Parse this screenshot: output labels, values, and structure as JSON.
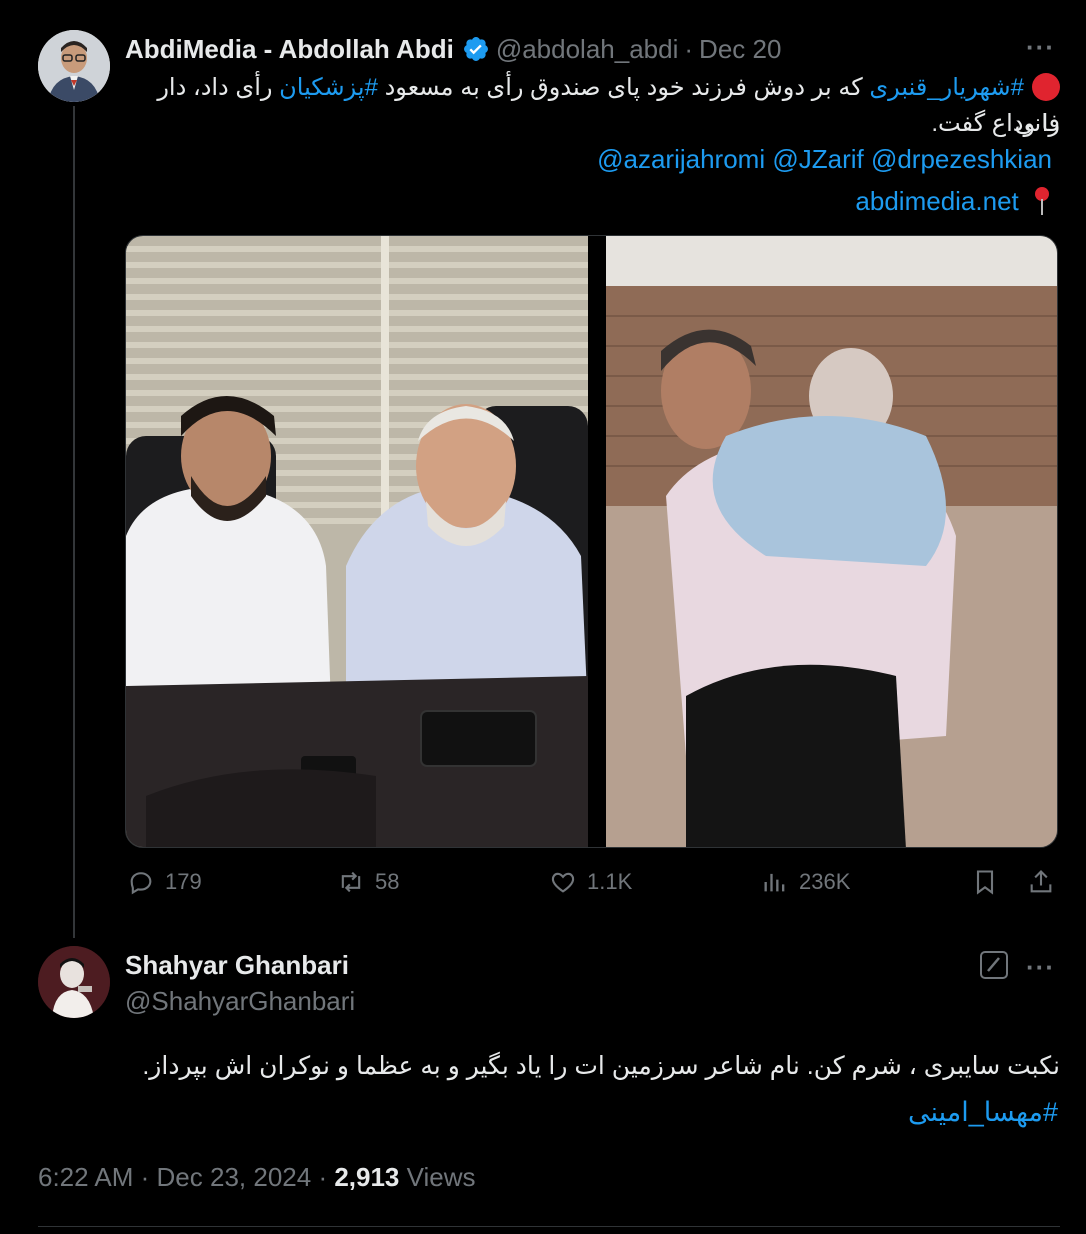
{
  "tweet1": {
    "display_name": "AbdiMedia - Abdollah Abdi",
    "handle": "@abdolah_abdi",
    "date": "Dec 20",
    "more": "···",
    "text_line1_hashtag1": "#شهریار_قنبری",
    "text_line1_middle": " که بر دوش فرزند خود پای صندوق رأی به مسعود ",
    "text_line1_hashtag2": "#پزشکیان",
    "text_line1_end": " رأی داد، دار فانی",
    "text_line2": "را وداع گفت.",
    "mentions": "@azarijahromi @JZarif @drpezeshkian",
    "site": "abdimedia.net",
    "stats": {
      "replies": "179",
      "reposts": "58",
      "likes": "1.1K",
      "views": "236K"
    }
  },
  "tweet2": {
    "display_name": "Shahyar Ghanbari",
    "handle": "@ShahyarGhanbari",
    "more": "···",
    "text": "نکبت سایبری ، شرم کن. نام شاعر سرزمین ات را یاد بگیر و به عظما و نوکران اش بپرداز.",
    "hashtag": "#مهسا_امینی",
    "time": "6:22 AM",
    "date": "Dec 23, 2024",
    "views_count": "2,913",
    "views_label": "Views"
  },
  "colors": {
    "background": "#000000",
    "text": "#e7e9ea",
    "muted": "#71767b",
    "link": "#1d9bf0",
    "verified": "#1d9bf0",
    "red_dot": "#e0242f"
  }
}
